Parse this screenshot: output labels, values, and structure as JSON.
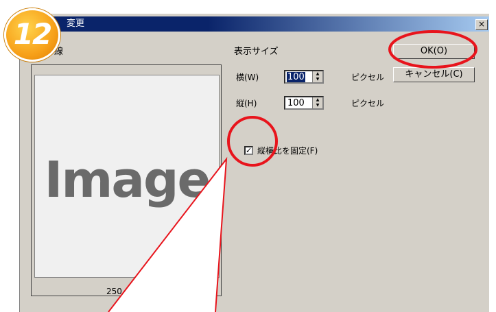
{
  "dialog": {
    "title": "変更",
    "close_label": "×",
    "preview_label": "線",
    "preview_image_text": "Image",
    "preview_size_text": "250",
    "display_size_label": "表示サイズ",
    "width_label": "横(W)",
    "width_value": "100",
    "height_label": "縦(H)",
    "height_value": "100",
    "unit_width": "ピクセル",
    "unit_height": "ピクセル",
    "aspect_lock_label": "縦横比を固定(F)",
    "aspect_lock_checked": true,
    "aspect_lock_mark": "✓",
    "ok_label": "OK(O)",
    "cancel_label": "キャンセル(C)"
  },
  "annotation": {
    "step_number": "12",
    "highlight_color": "#e8141c",
    "badge_color": "#f7a11a"
  }
}
